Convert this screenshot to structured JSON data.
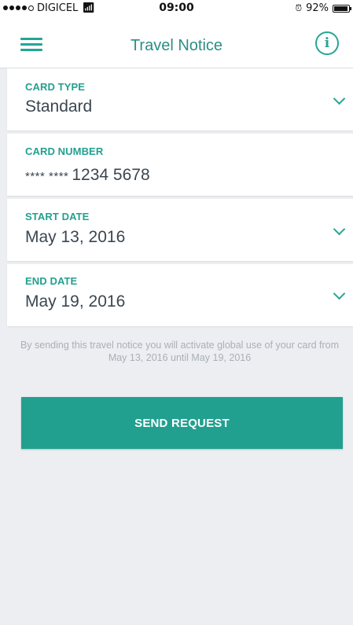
{
  "status_bar": {
    "carrier": "DIGICEL",
    "time": "09:00",
    "battery": "92%",
    "signal_icon": "signal-dots-icon",
    "wifi_icon": "wifi-icon",
    "alarm_icon": "alarm-icon",
    "battery_icon": "battery-icon"
  },
  "nav": {
    "title": "Travel Notice",
    "menu_icon": "hamburger-menu-icon",
    "info_icon": "info-icon",
    "info_glyph": "i"
  },
  "fields": {
    "card_type": {
      "label": "CARD TYPE",
      "value": "Standard"
    },
    "card_number": {
      "label": "CARD NUMBER",
      "mask": "**** ****",
      "value": "1234 5678"
    },
    "start_date": {
      "label": "START DATE",
      "value": "May 13, 2016"
    },
    "end_date": {
      "label": "END DATE",
      "value": "May 19, 2016"
    }
  },
  "notice": {
    "text": "By sending this travel notice you will activate global use of your card from May 13, 2016 until May 19, 2016"
  },
  "actions": {
    "send_label": "SEND REQUEST"
  },
  "colors": {
    "accent": "#22a08f",
    "label": "#23a08f",
    "value_text": "#3b4650",
    "background": "#eceef1",
    "notice_text": "#a9b0b7"
  }
}
